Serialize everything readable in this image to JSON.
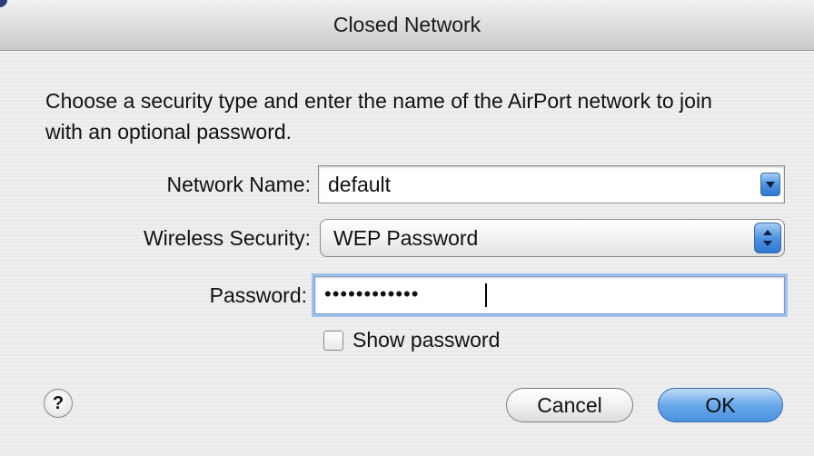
{
  "window": {
    "title": "Closed Network"
  },
  "dialog": {
    "instructions": "Choose a security type and enter the name of the AirPort network to join with an optional password."
  },
  "fields": {
    "network_name_label": "Network Name:",
    "network_name_value": "default",
    "wireless_security_label": "Wireless Security:",
    "wireless_security_value": "WEP Password",
    "password_label": "Password:",
    "password_masked": "••••••••••••",
    "show_password_label": "Show password",
    "show_password_checked": false
  },
  "buttons": {
    "help": "?",
    "cancel": "Cancel",
    "ok": "OK"
  },
  "icons": {
    "combo_arrow": "chevron-down-icon",
    "popup_arrows": "up-down-arrows-icon",
    "help": "question-mark-icon"
  },
  "colors": {
    "default_button": "#4a93e0",
    "focus_ring": "#9fc2ec"
  }
}
